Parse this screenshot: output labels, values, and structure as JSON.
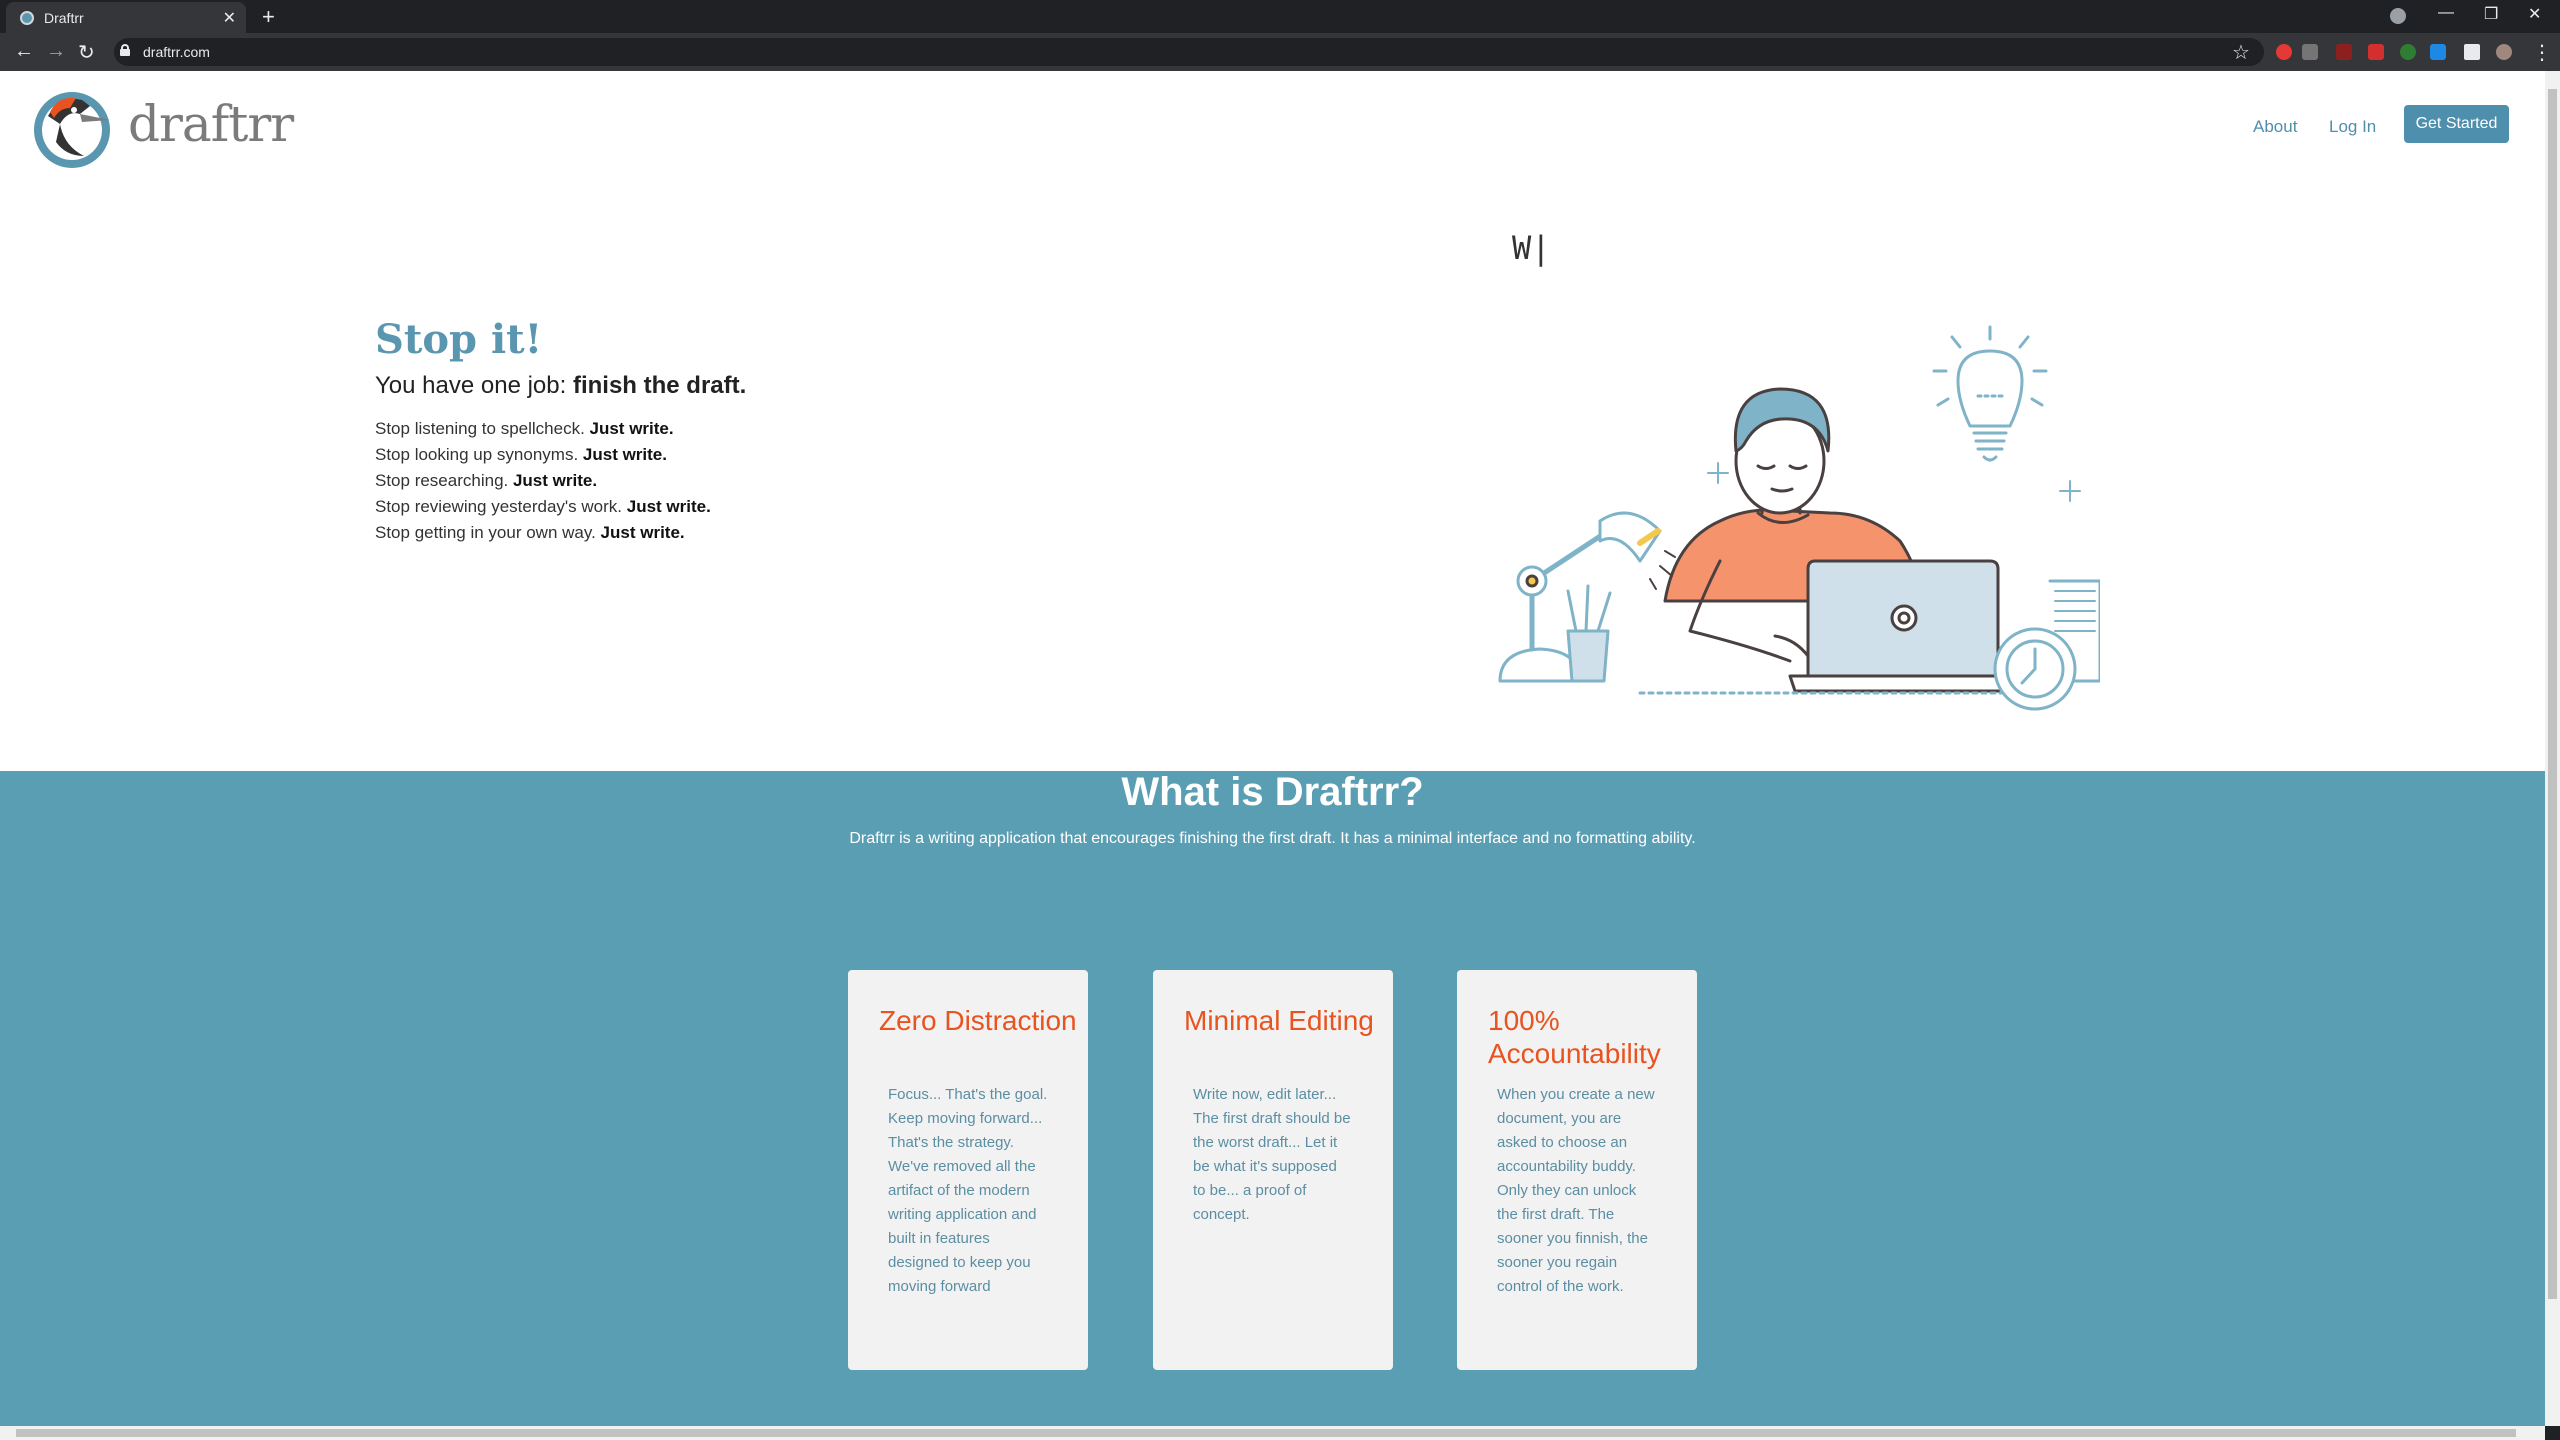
{
  "browser": {
    "tab_title": "Draftrr",
    "url": "draftrr.com",
    "new_tab": "+",
    "close": "✕"
  },
  "header": {
    "brand": "draftrr",
    "nav": [
      {
        "label": "About"
      },
      {
        "label": "Log In"
      }
    ],
    "cta": "Get Started"
  },
  "hero": {
    "title": "Stop it!",
    "subtitle_lead": "You have one job: ",
    "subtitle_bold": "finish the draft.",
    "typewriter": "W|",
    "lines": [
      {
        "text": "Stop listening to spellcheck. ",
        "bold": "Just write."
      },
      {
        "text": "Stop looking up synonyms. ",
        "bold": "Just write."
      },
      {
        "text": "Stop researching. ",
        "bold": "Just write."
      },
      {
        "text": "Stop reviewing yesterday's work. ",
        "bold": "Just write."
      },
      {
        "text": "Stop getting in your own way. ",
        "bold": "Just write."
      }
    ]
  },
  "what": {
    "title": "What is Draftrr?",
    "description": "Draftrr is a writing application that encourages finishing the first draft. It has a minimal interface and no formatting ability.",
    "cards": [
      {
        "title": "Zero Distraction",
        "body": "Focus... That's the goal. Keep moving forward... That's the strategy. We've removed all the artifact of the modern writing application and built in features designed to keep you moving forward"
      },
      {
        "title": "Minimal Editing",
        "body": "Write now, edit later... The first draft should be the worst draft... Let it be what it's supposed to be... a proof of concept."
      },
      {
        "title": "100% Accountability",
        "body": "When you create a new document, you are asked to choose an accountability buddy. Only they can unlock the first draft. The sooner you finnish, the sooner you regain control of the work."
      }
    ]
  },
  "colors": {
    "brand_blue": "#5a96b0",
    "section_bg": "#5a9eb4",
    "card_title": "#e8531f",
    "illustration_orange": "#f5936d"
  }
}
